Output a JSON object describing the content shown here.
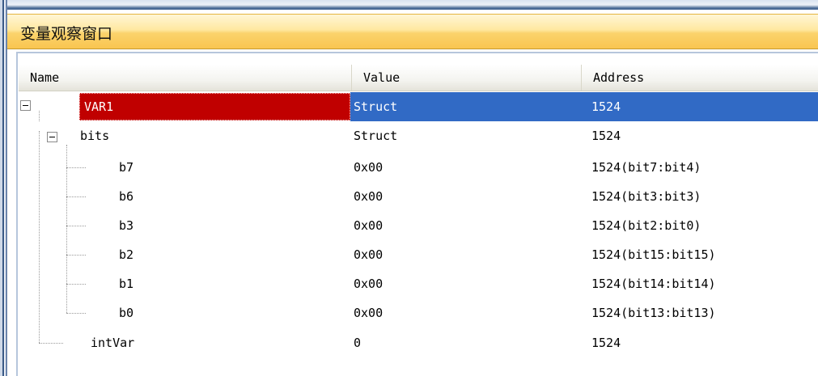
{
  "window": {
    "title": "变量观察窗口"
  },
  "columns": {
    "name": "Name",
    "value": "Value",
    "address": "Address"
  },
  "rows": [
    {
      "name": "VAR1",
      "value": "Struct",
      "address": "1524"
    },
    {
      "name": "bits",
      "value": "Struct",
      "address": "1524"
    },
    {
      "name": "b7",
      "value": "0x00",
      "address": "1524(bit7:bit4)"
    },
    {
      "name": "b6",
      "value": "0x00",
      "address": "1524(bit3:bit3)"
    },
    {
      "name": "b3",
      "value": "0x00",
      "address": "1524(bit2:bit0)"
    },
    {
      "name": "b2",
      "value": "0x00",
      "address": "1524(bit15:bit15)"
    },
    {
      "name": "b1",
      "value": "0x00",
      "address": "1524(bit14:bit14)"
    },
    {
      "name": "b0",
      "value": "0x00",
      "address": "1524(bit13:bit13)"
    },
    {
      "name": "intVar",
      "value": "0",
      "address": "1524"
    }
  ],
  "selected_row": "VAR1",
  "colors": {
    "selection": "#316ac5",
    "name_highlight": "#c00000",
    "title_gradient": "#fbd36c"
  }
}
